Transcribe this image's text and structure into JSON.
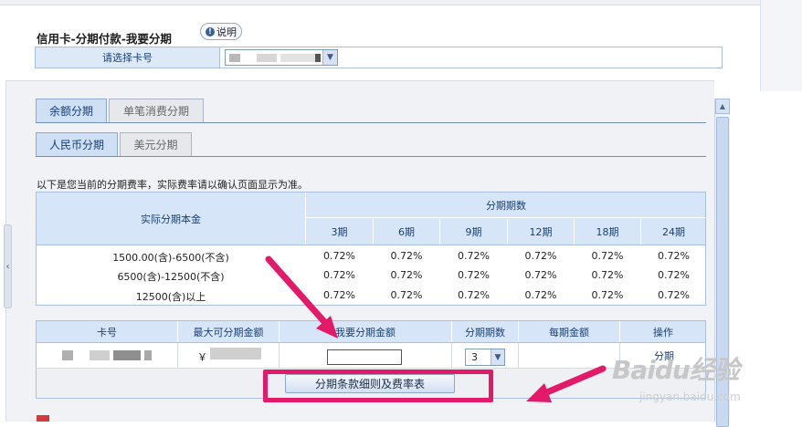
{
  "page": {
    "title": "信用卡-分期付款-我要分期",
    "help_label": "说明",
    "help_icon_glyph": "!"
  },
  "card_select": {
    "label": "请选择卡号",
    "dropdown_glyph": "▼"
  },
  "tabs_type": [
    {
      "label": "余额分期",
      "active": true
    },
    {
      "label": "单笔消费分期",
      "active": false
    }
  ],
  "tabs_currency": [
    {
      "label": "人民币分期",
      "active": true
    },
    {
      "label": "美元分期",
      "active": false
    }
  ],
  "note": "以下是您当前的分期费率，实际费率请以确认页面显示为准。",
  "rate_table": {
    "principal_header": "实际分期本金",
    "period_header": "分期期数",
    "periods": [
      "3期",
      "6期",
      "9期",
      "12期",
      "18期",
      "24期"
    ],
    "rows": [
      {
        "range": "1500.00(含)-6500(不含)",
        "rates": [
          "0.72%",
          "0.72%",
          "0.72%",
          "0.72%",
          "0.72%",
          "0.72%"
        ]
      },
      {
        "range": "6500(含)-12500(不含)",
        "rates": [
          "0.72%",
          "0.72%",
          "0.72%",
          "0.72%",
          "0.72%",
          "0.72%"
        ]
      },
      {
        "range": "12500(含)以上",
        "rates": [
          "0.72%",
          "0.72%",
          "0.72%",
          "0.72%",
          "0.72%",
          "0.72%"
        ]
      }
    ]
  },
  "install_table": {
    "headers": [
      "卡号",
      "最大可分期金额",
      "我要分期金额",
      "分期期数",
      "每期金额",
      "操作"
    ],
    "max_amount_prefix": "￥",
    "period_value": "3",
    "action_label": "分期"
  },
  "terms_button": "分期条款细则及费率表",
  "watermark": {
    "logo": "Baidu经验",
    "sub": "jingyan.baidu.com"
  },
  "colors": {
    "highlight": "#e31a6a",
    "header_bg": "#d6e6f8",
    "header_text": "#1b3f72"
  },
  "scroll_up_glyph": "▲",
  "left_handle_glyph": "‹"
}
